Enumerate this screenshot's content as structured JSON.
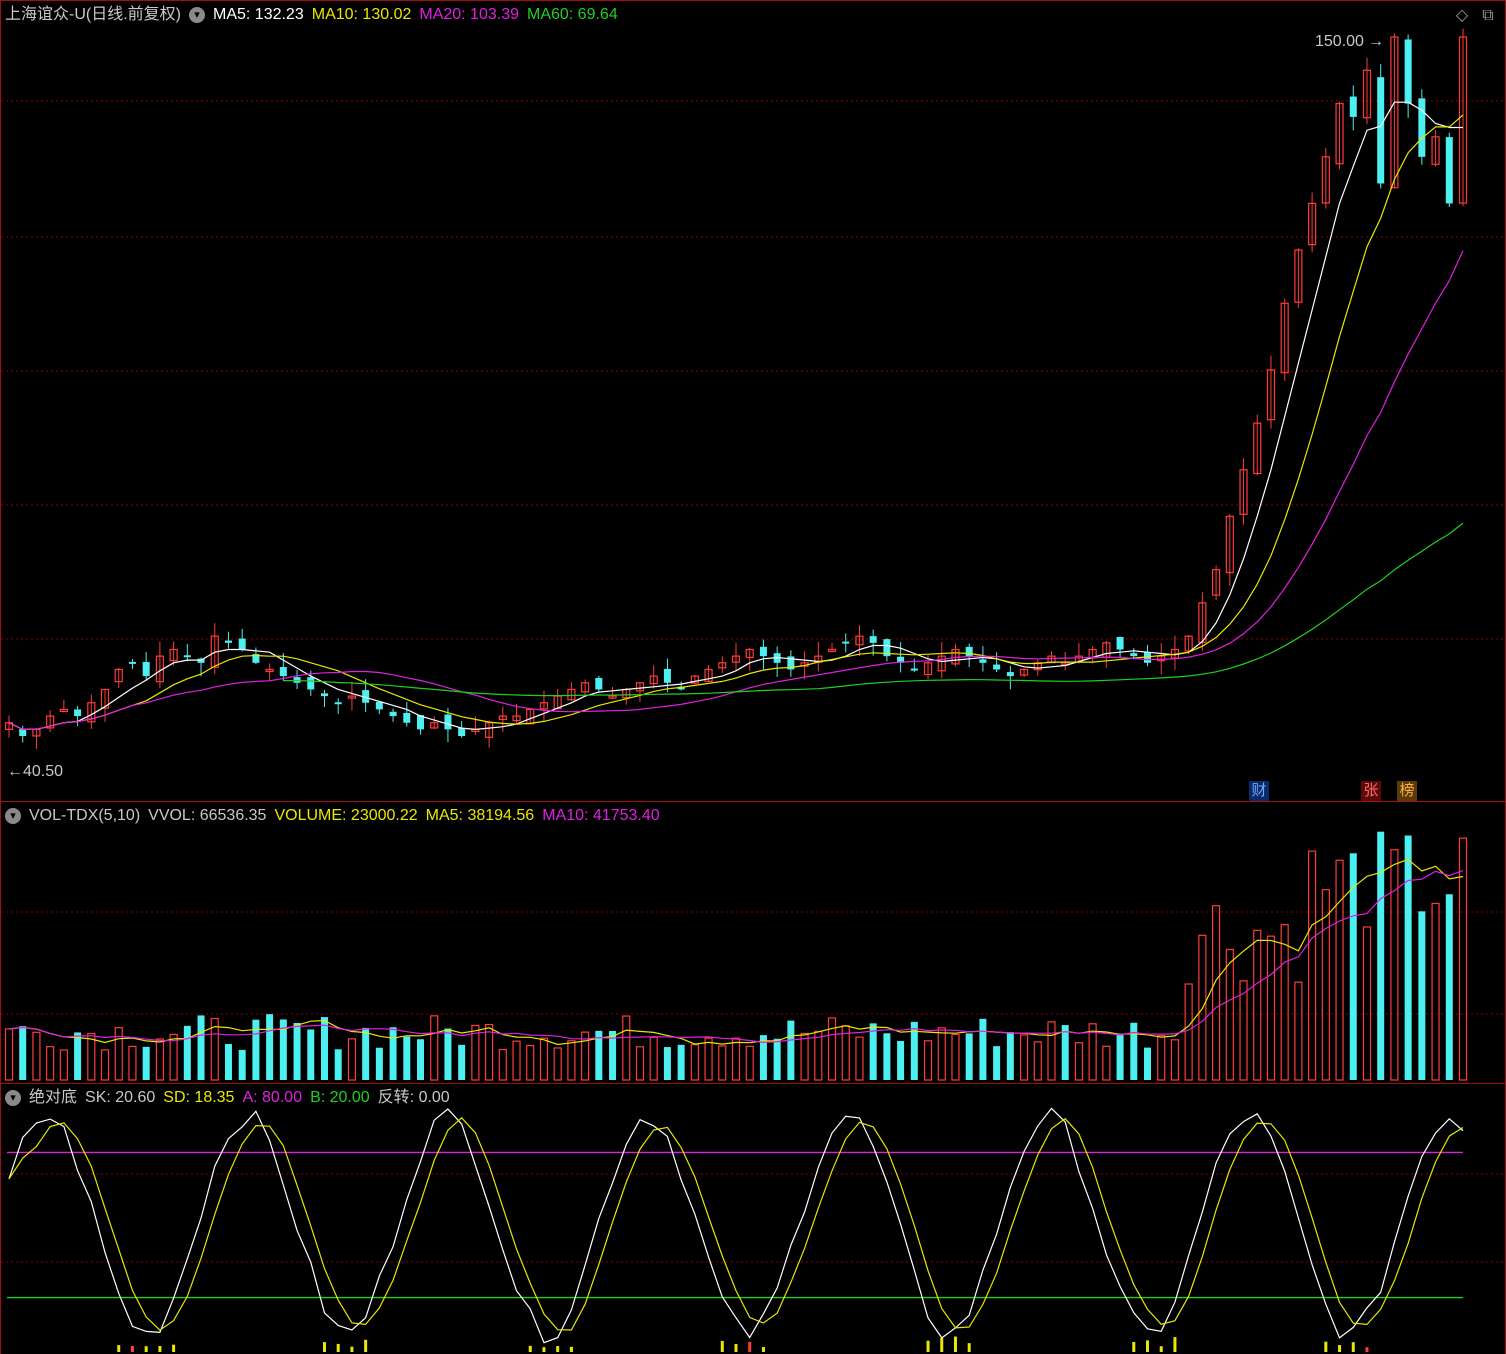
{
  "colors": {
    "up": "#ff3b3b",
    "down": "#4df0f0",
    "ma5": "#ffffff",
    "ma10": "#e8e800",
    "ma20": "#e020e0",
    "ma60": "#20d020",
    "grid": "#8b0000",
    "label_gray": "#c8c8c8"
  },
  "price_pane": {
    "stock_title": "上海谊众-U(日线.前复权)",
    "ma5_label": "MA5: 132.23",
    "ma10_label": "MA10: 130.02",
    "ma20_label": "MA20: 103.39",
    "ma60_label": "MA60: 69.64",
    "high_marker": "150.00",
    "low_marker": "40.50",
    "tags": {
      "cai": "财",
      "zhang": "张",
      "bang": "榜"
    },
    "icons": [
      "chevron-down-icon",
      "diamond-icon",
      "restore-icon"
    ]
  },
  "volume_pane": {
    "name_label": "VOL-TDX(5,10)",
    "vvol_label": "VVOL: 66536.35",
    "volume_label": "VOLUME: 23000.22",
    "ma5_label": "MA5: 38194.56",
    "ma10_label": "MA10: 41753.40"
  },
  "indicator_pane": {
    "name_label": "绝对底",
    "sk_label": "SK: 20.60",
    "sd_label": "SD: 18.35",
    "a_label": "A: 80.00",
    "b_label": "B: 20.00",
    "fanzhuan_label": "反转: 0.00",
    "a_level": 80,
    "b_level": 20
  },
  "chart_data": {
    "type": "candlestick",
    "y_range": [
      40.5,
      150.0
    ],
    "closes_shape": [
      47,
      45,
      46,
      48,
      49,
      48,
      50,
      52,
      55,
      56,
      54,
      57,
      58,
      57,
      56,
      60,
      59,
      58,
      56,
      55,
      54,
      53,
      52,
      51,
      50,
      51,
      50,
      49,
      48,
      47,
      46,
      47,
      46,
      45,
      46,
      47,
      48,
      48,
      49,
      50,
      51,
      52,
      53,
      52,
      51,
      52,
      53,
      54,
      53,
      52,
      54,
      55,
      56,
      57,
      58,
      57,
      56,
      55,
      56,
      57,
      58,
      59,
      60,
      59,
      57,
      56,
      55,
      56,
      57,
      58,
      57,
      56,
      55,
      54,
      55,
      56,
      57,
      56,
      57,
      58,
      59,
      58,
      57,
      56,
      57,
      58,
      60,
      65,
      70,
      78,
      85,
      92,
      100,
      110,
      118,
      125,
      132,
      140,
      138,
      145,
      128,
      150,
      140,
      132,
      135,
      125,
      150
    ]
  }
}
